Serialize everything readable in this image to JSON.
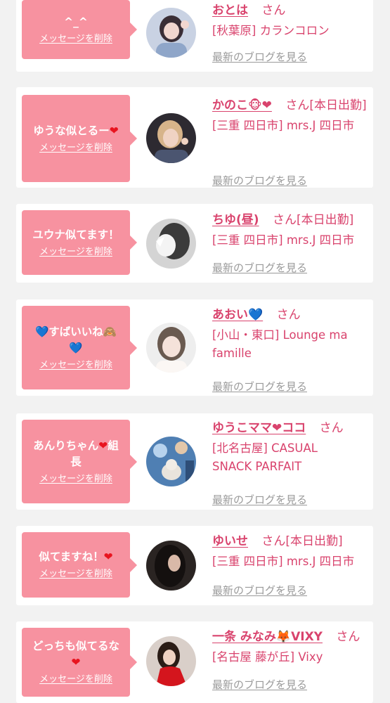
{
  "cards": [
    {
      "message": "^_^",
      "delete_label": "メッセージを削除",
      "name": "おとは",
      "honorific": "さん",
      "status": "",
      "shop": "[秋葉原] カランコロン",
      "blog_link": "最新のブログを見る"
    },
    {
      "message": "ゆうな似とるー❤",
      "delete_label": "メッセージを削除",
      "name": "かのこ🐵❤",
      "honorific": "さん",
      "status": "[本日出勤]",
      "shop": "[三重 四日市] mrs.J 四日市",
      "blog_link": "最新のブログを見る"
    },
    {
      "message": "ユウナ似てます！",
      "delete_label": "メッセージを削除",
      "name": "ちゆ(昼)",
      "honorific": "さん",
      "status": "[本日出勤]",
      "shop": "[三重 四日市] mrs.J 四日市",
      "blog_link": "最新のブログを見る"
    },
    {
      "message": "💙すばいいね🙈💙",
      "delete_label": "メッセージを削除",
      "name": "あおい💙",
      "honorific": "さん",
      "status": "",
      "shop": "[小山・東口] Lounge ma famille",
      "blog_link": "最新のブログを見る"
    },
    {
      "message": "あんりちゃん❤組長",
      "delete_label": "メッセージを削除",
      "name": "ゆうこママ❤ココ",
      "honorific": "さん",
      "status": "",
      "shop": "[北名古屋] CASUAL SNACK PARFAIT",
      "blog_link": "最新のブログを見る"
    },
    {
      "message": "似てますね！❤",
      "delete_label": "メッセージを削除",
      "name": "ゆいせ",
      "honorific": "さん",
      "status": "[本日出勤]",
      "shop": "[三重 四日市] mrs.J 四日市",
      "blog_link": "最新のブログを見る"
    },
    {
      "message": "どっちも似てるな❤",
      "delete_label": "メッセージを削除",
      "name": "一条 みなみ🦊VIXY",
      "honorific": "さん",
      "status": "",
      "shop": "[名古屋 藤が丘] Vixy",
      "blog_link": "最新のブログを見る"
    }
  ],
  "colors": {
    "bubble": "#f792a0",
    "accent": "#d9436d",
    "link_gray": "#9a9a9a",
    "background": "#f2f2f2"
  }
}
